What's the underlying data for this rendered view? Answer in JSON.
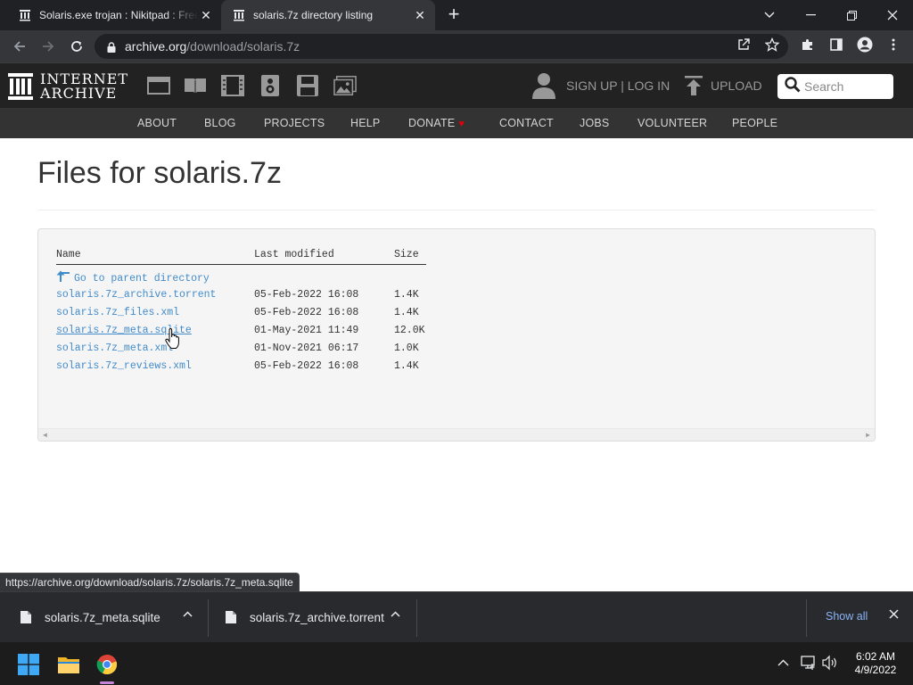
{
  "browser": {
    "tabs": [
      {
        "title": "Solaris.exe trojan : Nikitpad : Free",
        "active": false
      },
      {
        "title": "solaris.7z directory listing",
        "active": true
      }
    ],
    "new_tab_symbol": "+",
    "url_host": "archive.org",
    "url_path": "/download/solaris.7z",
    "status_url": "https://archive.org/download/solaris.7z/solaris.7z_meta.sqlite"
  },
  "ia_header": {
    "logo_line1": "INTERNET",
    "logo_line2": "ARCHIVE",
    "media_icons": [
      "web-icon",
      "texts-icon",
      "video-icon",
      "audio-icon",
      "software-icon",
      "images-icon"
    ],
    "signup_label": "SIGN UP | LOG IN",
    "upload_label": "UPLOAD",
    "search_placeholder": "Search"
  },
  "ia_nav": [
    "ABOUT",
    "BLOG",
    "PROJECTS",
    "HELP",
    "DONATE",
    "CONTACT",
    "JOBS",
    "VOLUNTEER",
    "PEOPLE"
  ],
  "content": {
    "title": "Files for solaris.7z",
    "columns": [
      "Name",
      "Last modified",
      "Size"
    ],
    "parent_label": "Go to parent directory",
    "files": [
      {
        "name": "solaris.7z_archive.torrent",
        "modified": "05-Feb-2022 16:08",
        "size": "1.4K"
      },
      {
        "name": "solaris.7z_files.xml",
        "modified": "05-Feb-2022 16:08",
        "size": "1.4K"
      },
      {
        "name": "solaris.7z_meta.sqlite",
        "modified": "01-May-2021 11:49",
        "size": "12.0K"
      },
      {
        "name": "solaris.7z_meta.xml",
        "modified": "01-Nov-2021 06:17",
        "size": "1.0K"
      },
      {
        "name": "solaris.7z_reviews.xml",
        "modified": "05-Feb-2022 16:08",
        "size": "1.4K"
      }
    ]
  },
  "downloads": {
    "items": [
      "solaris.7z_meta.sqlite",
      "solaris.7z_archive.torrent"
    ],
    "show_all_label": "Show all"
  },
  "taskbar": {
    "time": "6:02 AM",
    "date": "4/9/2022"
  },
  "colors": {
    "link": "#428bca",
    "ia_header_bg": "#222222",
    "ia_nav_bg": "#333333",
    "donate_heart": "#e3000b",
    "show_all": "#8ab4f8"
  }
}
